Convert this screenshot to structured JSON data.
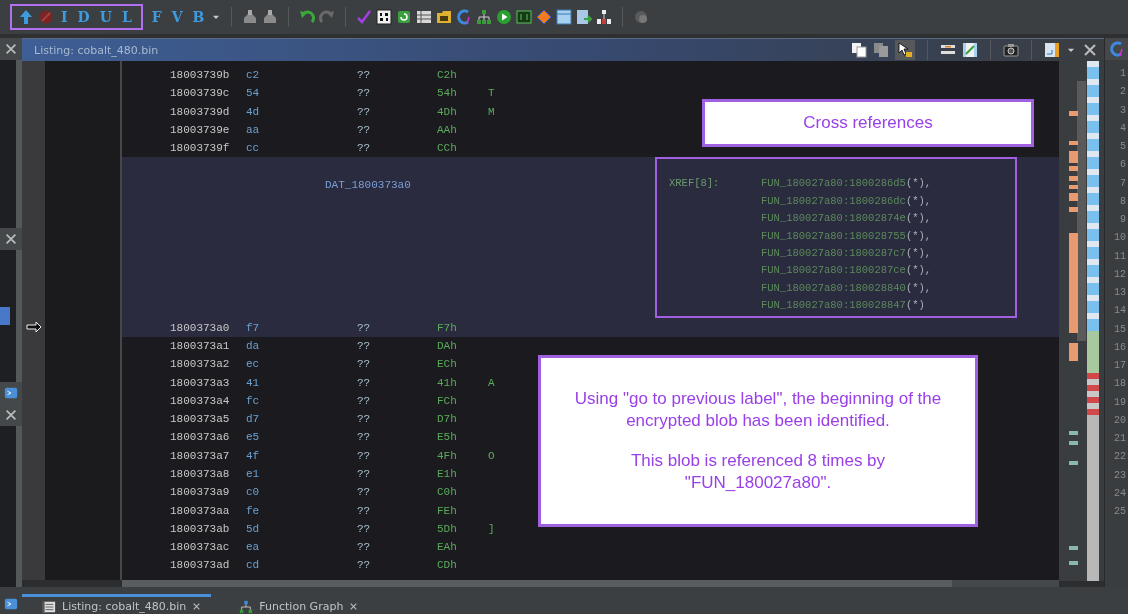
{
  "toolbar": {
    "framed": [
      {
        "kind": "up-arrow"
      },
      {
        "kind": "no-entry"
      },
      {
        "kind": "letter",
        "label": "I"
      },
      {
        "kind": "letter",
        "label": "D"
      },
      {
        "kind": "letter",
        "label": "U"
      },
      {
        "kind": "letter",
        "label": "L"
      }
    ],
    "items": [
      {
        "kind": "letter",
        "label": "F"
      },
      {
        "kind": "letter",
        "label": "V"
      },
      {
        "kind": "letter",
        "label": "B"
      },
      {
        "kind": "dropdown"
      },
      {
        "kind": "separator"
      },
      {
        "kind": "stamp"
      },
      {
        "kind": "stamp"
      },
      {
        "kind": "separator"
      },
      {
        "kind": "undo"
      },
      {
        "kind": "redo"
      },
      {
        "kind": "separator"
      },
      {
        "kind": "check"
      },
      {
        "kind": "binary"
      },
      {
        "kind": "refresh"
      },
      {
        "kind": "table"
      },
      {
        "kind": "folder"
      },
      {
        "kind": "arc"
      },
      {
        "kind": "tree"
      },
      {
        "kind": "play"
      },
      {
        "kind": "terminal"
      },
      {
        "kind": "diamond"
      },
      {
        "kind": "window"
      },
      {
        "kind": "export"
      },
      {
        "kind": "blocks"
      },
      {
        "kind": "separator"
      },
      {
        "kind": "circle"
      }
    ]
  },
  "listing": {
    "title": "Listing: cobalt_480.bin",
    "tools": [
      {
        "kind": "copy"
      },
      {
        "kind": "paste"
      },
      {
        "kind": "cursor"
      },
      {
        "kind": "separator"
      },
      {
        "kind": "bar"
      },
      {
        "kind": "split"
      },
      {
        "kind": "separator"
      },
      {
        "kind": "camera"
      },
      {
        "kind": "separator"
      },
      {
        "kind": "doc"
      },
      {
        "kind": "dropdown"
      },
      {
        "kind": "close"
      }
    ],
    "rows": [
      {
        "kind": "byte",
        "selected": false,
        "address": "18003739b",
        "bytes": "c2",
        "mnemonic": "??",
        "value": "C2h"
      },
      {
        "kind": "byte",
        "selected": false,
        "address": "18003739c",
        "bytes": "54",
        "mnemonic": "??",
        "value": "54h",
        "char": "T"
      },
      {
        "kind": "byte",
        "selected": false,
        "address": "18003739d",
        "bytes": "4d",
        "mnemonic": "??",
        "value": "4Dh",
        "char": "M"
      },
      {
        "kind": "byte",
        "selected": false,
        "address": "18003739e",
        "bytes": "aa",
        "mnemonic": "??",
        "value": "AAh"
      },
      {
        "kind": "byte",
        "selected": false,
        "address": "18003739f",
        "bytes": "cc",
        "mnemonic": "??",
        "value": "CCh"
      },
      {
        "kind": "label",
        "selected": true,
        "label": "DAT_1800373a0",
        "xref_label": "XREF[8]:",
        "xrefs": [
          {
            "ref": "FUN_180027a80:1800286d5",
            "suffix": "(*),"
          },
          {
            "ref": "FUN_180027a80:1800286dc",
            "suffix": "(*),"
          },
          {
            "ref": "FUN_180027a80:18002874e",
            "suffix": "(*),"
          },
          {
            "ref": "FUN_180027a80:180028755",
            "suffix": "(*),"
          },
          {
            "ref": "FUN_180027a80:1800287c7",
            "suffix": "(*),"
          },
          {
            "ref": "FUN_180027a80:1800287ce",
            "suffix": "(*),"
          },
          {
            "ref": "FUN_180027a80:180028840",
            "suffix": "(*),"
          },
          {
            "ref": "FUN_180027a80:180028847",
            "suffix": "(*)"
          }
        ]
      },
      {
        "kind": "byte",
        "selected": true,
        "address": "1800373a0",
        "bytes": "f7",
        "mnemonic": "??",
        "value": "F7h"
      },
      {
        "kind": "byte",
        "selected": false,
        "address": "1800373a1",
        "bytes": "da",
        "mnemonic": "??",
        "value": "DAh"
      },
      {
        "kind": "byte",
        "selected": false,
        "address": "1800373a2",
        "bytes": "ec",
        "mnemonic": "??",
        "value": "ECh"
      },
      {
        "kind": "byte",
        "selected": false,
        "address": "1800373a3",
        "bytes": "41",
        "mnemonic": "??",
        "value": "41h",
        "char": "A"
      },
      {
        "kind": "byte",
        "selected": false,
        "address": "1800373a4",
        "bytes": "fc",
        "mnemonic": "??",
        "value": "FCh"
      },
      {
        "kind": "byte",
        "selected": false,
        "address": "1800373a5",
        "bytes": "d7",
        "mnemonic": "??",
        "value": "D7h"
      },
      {
        "kind": "byte",
        "selected": false,
        "address": "1800373a6",
        "bytes": "e5",
        "mnemonic": "??",
        "value": "E5h"
      },
      {
        "kind": "byte",
        "selected": false,
        "address": "1800373a7",
        "bytes": "4f",
        "mnemonic": "??",
        "value": "4Fh",
        "char": "O"
      },
      {
        "kind": "byte",
        "selected": false,
        "address": "1800373a8",
        "bytes": "e1",
        "mnemonic": "??",
        "value": "E1h"
      },
      {
        "kind": "byte",
        "selected": false,
        "address": "1800373a9",
        "bytes": "c0",
        "mnemonic": "??",
        "value": "C0h"
      },
      {
        "kind": "byte",
        "selected": false,
        "address": "1800373aa",
        "bytes": "fe",
        "mnemonic": "??",
        "value": "FEh"
      },
      {
        "kind": "byte",
        "selected": false,
        "address": "1800373ab",
        "bytes": "5d",
        "mnemonic": "??",
        "value": "5Dh",
        "char": "]"
      },
      {
        "kind": "byte",
        "selected": false,
        "address": "1800373ac",
        "bytes": "ea",
        "mnemonic": "??",
        "value": "EAh"
      },
      {
        "kind": "byte",
        "selected": false,
        "address": "1800373ad",
        "bytes": "cd",
        "mnemonic": "??",
        "value": "CDh"
      }
    ]
  },
  "callouts": [
    {
      "kind": "title",
      "text": "Cross references"
    },
    {
      "kind": "note",
      "paragraphs": [
        "Using \"go to previous label\", the beginning of the encrypted blob has been identified.",
        "This blob is referenced 8 times by \"FUN_180027a80\"."
      ]
    }
  ],
  "line_numbers": [
    "1",
    "2",
    "3",
    "4",
    "5",
    "6",
    "7",
    "8",
    "9",
    "10",
    "11",
    "12",
    "13",
    "14",
    "15",
    "16",
    "17",
    "18",
    "19",
    "20",
    "21",
    "22",
    "23",
    "24",
    "25"
  ],
  "bottom_tabs": [
    {
      "label": "Listing: cobalt_480.bin",
      "kind": "listing",
      "selected": true
    },
    {
      "label": "Function Graph",
      "kind": "graph",
      "selected": false
    }
  ]
}
